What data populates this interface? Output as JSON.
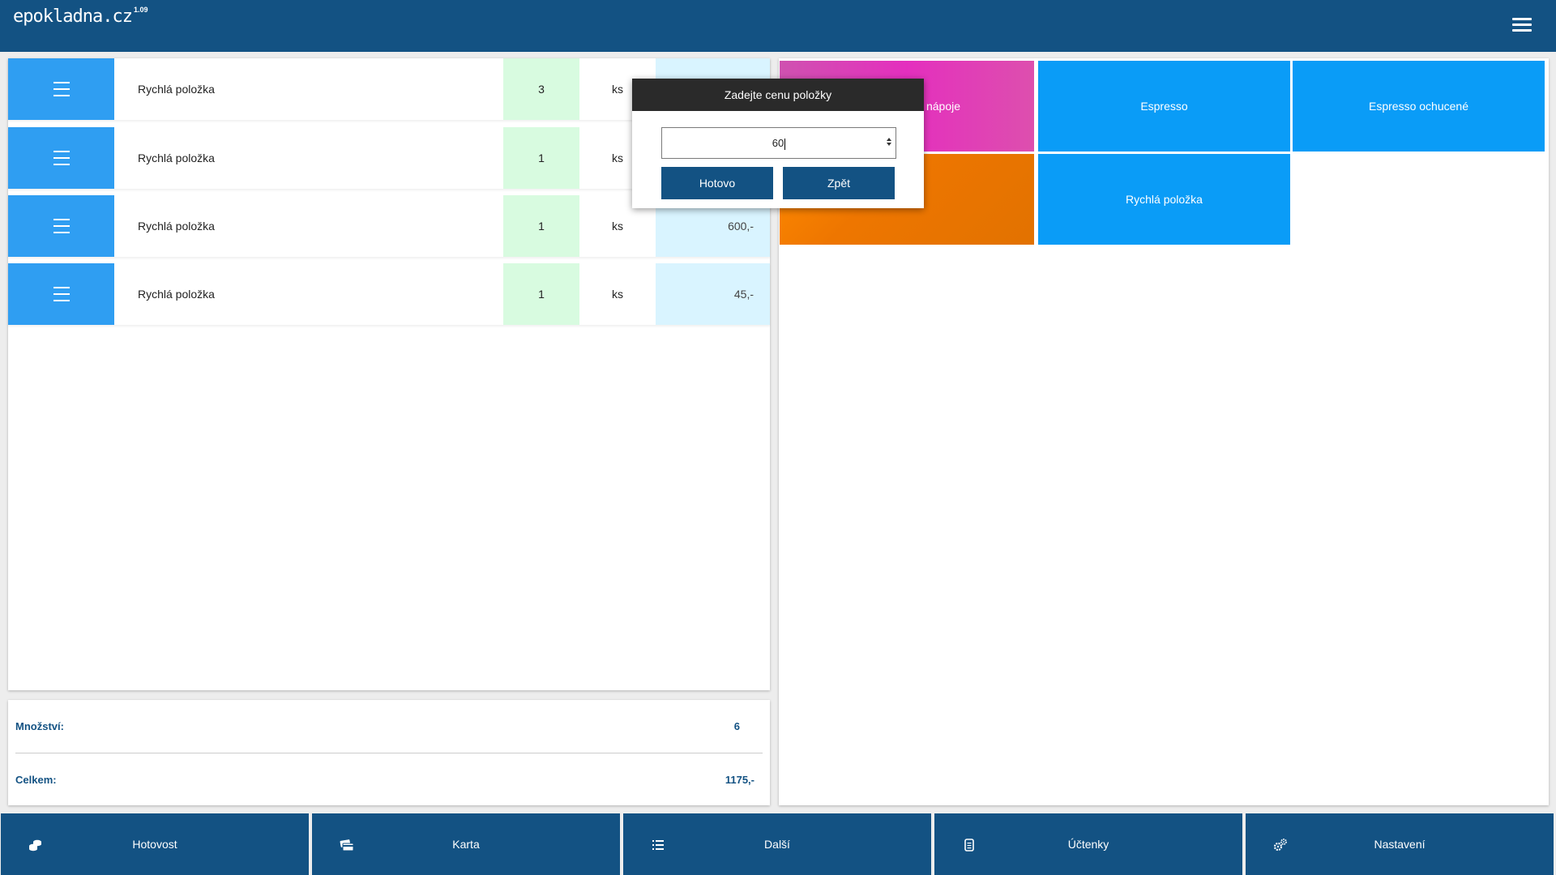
{
  "header": {
    "logo": "epokladna.cz",
    "version": "1.09"
  },
  "order": {
    "rows": [
      {
        "name": "Rychlá položka",
        "qty": "3",
        "unit": "ks",
        "price": ""
      },
      {
        "name": "Rychlá položka",
        "qty": "1",
        "unit": "ks",
        "price": ""
      },
      {
        "name": "Rychlá položka",
        "qty": "1",
        "unit": "ks",
        "price": "600,-"
      },
      {
        "name": "Rychlá položka",
        "qty": "1",
        "unit": "ks",
        "price": "45,-"
      }
    ]
  },
  "summary": {
    "quantity_label": "Množství:",
    "quantity_value": "6",
    "total_label": "Celkem:",
    "total_value": "1175,-"
  },
  "tiles": [
    {
      "label": "nápoje",
      "color": "#e83cb4"
    },
    {
      "label": "Espresso",
      "color": "#0a9cf7"
    },
    {
      "label": "Espresso ochucené",
      "color": "#0a9cf7"
    },
    {
      "label": "",
      "color": "#ef7a00"
    },
    {
      "label": "Rychlá položka",
      "color": "#0a9cf7"
    }
  ],
  "dialog": {
    "title": "Zadejte cenu položky",
    "value": "60",
    "ok_label": "Hotovo",
    "back_label": "Zpět"
  },
  "bottom": {
    "cash": "Hotovost",
    "card": "Karta",
    "more": "Další",
    "receipts": "Účtenky",
    "settings": "Nastavení"
  },
  "colors": {
    "primary": "#135283",
    "accent": "#2f9ef2"
  }
}
